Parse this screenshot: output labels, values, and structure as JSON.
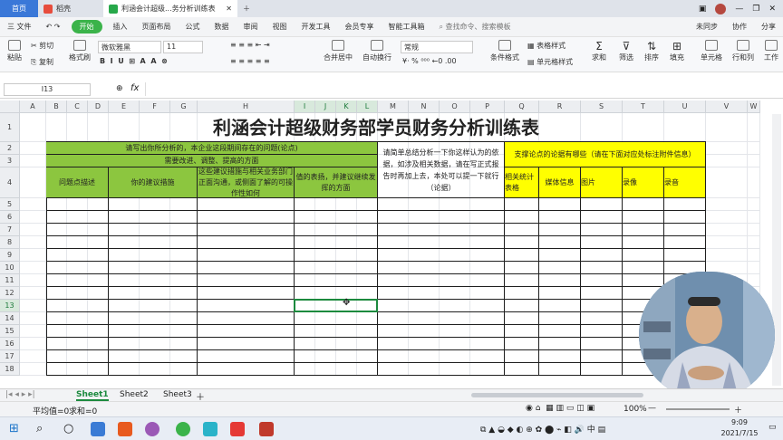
{
  "tabs": {
    "home": "首页",
    "t2": "稻壳",
    "active": "利涵会计超级...务分析训练表"
  },
  "menubar": {
    "file": "三 文件",
    "items": [
      "开始",
      "插入",
      "页面布局",
      "公式",
      "数据",
      "审阅",
      "视图",
      "开发工具",
      "会员专享",
      "智能工具箱"
    ],
    "search": "查找命令、搜索模板",
    "cloud": "未同步",
    "collab": "协作",
    "share": "分享"
  },
  "ribbon": {
    "paste": "粘贴",
    "cut": "剪切",
    "copy": "复制",
    "painter": "格式刷",
    "font": "微软雅黑",
    "size": "11",
    "merge": "合并居中",
    "wrap": "自动换行",
    "numfmt": "常规",
    "table_style": "表格样式",
    "cell_style": "单元格样式",
    "cond": "条件格式",
    "sum": "求和",
    "filter": "筛选",
    "sort": "排序",
    "fill": "填充",
    "cell": "单元格",
    "rowcol": "行和列",
    "sheet": "工作"
  },
  "formula": {
    "namebox": "I13",
    "fx": "fx",
    "value": ""
  },
  "columns": [
    "A",
    "B",
    "C",
    "D",
    "E",
    "F",
    "G",
    "H",
    "I",
    "J",
    "K",
    "L",
    "M",
    "N",
    "O",
    "P",
    "Q",
    "R",
    "S",
    "T",
    "U",
    "V",
    "W"
  ],
  "rows": [
    "1",
    "2",
    "3",
    "4",
    "5",
    "6",
    "7",
    "8",
    "9",
    "10",
    "11",
    "12",
    "13",
    "14",
    "15",
    "16",
    "17",
    "18"
  ],
  "sheet": {
    "title": "利涵会计超级财务部学员财务分析训练表",
    "r2_green": "请写出你所分析的，本企业这段期间存在的问题(论点)",
    "r3_green": "需要改进、调整、提高的方面",
    "r2_white": "请简单总结分析一下你这样认为的依据，如涉及相关数据，请在写正式报告时再加上去，本处可以提一下就行（论据）",
    "r2_yellow": "支撑论点的论据有哪些（请在下面对应处标注附件信息）",
    "h_problem": "问题点描述",
    "h_suggest": "你的建议措施",
    "h_feasible": "这些建议措施与相关业务部门正面沟通，或侧面了解的可操作性如何",
    "h_value": "值的表扬，并建议继续发挥的方面",
    "h_stats": "相关统计表格",
    "h_media": "媒体信息",
    "h_image": "图片",
    "h_video": "录像",
    "h_audio": "录音"
  },
  "sheets": [
    "Sheet1",
    "Sheet2",
    "Sheet3"
  ],
  "status": {
    "avg": "平均值=0",
    "sum": "求和=0",
    "zoom": "100%"
  },
  "clock": {
    "time": "9:09",
    "date": "2021/7/15"
  }
}
